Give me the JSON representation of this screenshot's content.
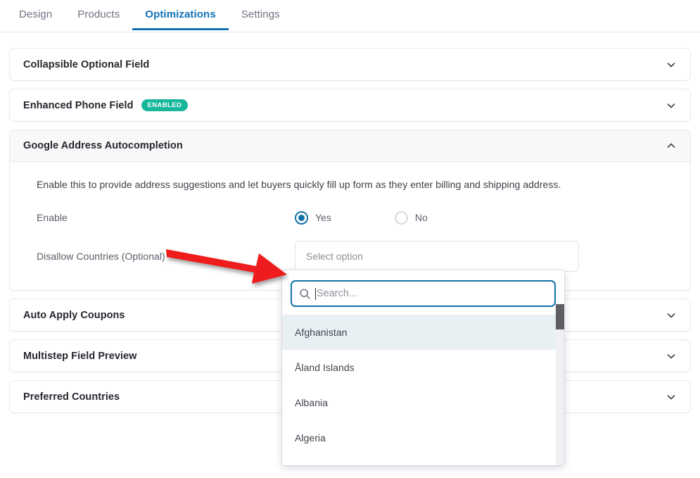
{
  "tabs": [
    {
      "label": "Design",
      "active": false
    },
    {
      "label": "Products",
      "active": false
    },
    {
      "label": "Optimizations",
      "active": true
    },
    {
      "label": "Settings",
      "active": false
    }
  ],
  "panels": {
    "collapsible_optional_field": {
      "title": "Collapsible Optional Field",
      "chevron": "chevron-down-icon"
    },
    "enhanced_phone_field": {
      "title": "Enhanced Phone Field",
      "badge": "ENABLED",
      "chevron": "chevron-down-icon"
    },
    "google_address_autocompletion": {
      "title": "Google Address Autocompletion",
      "chevron": "chevron-up-icon",
      "description": "Enable this to provide address suggestions and let buyers quickly fill up form as they enter billing and shipping address.",
      "enable": {
        "label": "Enable",
        "options": [
          {
            "label": "Yes",
            "selected": true
          },
          {
            "label": "No",
            "selected": false
          }
        ]
      },
      "disallow_countries": {
        "label": "Disallow Countries (Optional)",
        "select_placeholder": "Select option"
      }
    },
    "auto_apply_coupons": {
      "title": "Auto Apply Coupons",
      "chevron": "chevron-down-icon"
    },
    "multistep_field_preview": {
      "title": "Multistep Field Preview",
      "chevron": "chevron-down-icon"
    },
    "preferred_countries": {
      "title": "Preferred Countries",
      "chevron": "chevron-down-icon"
    }
  },
  "dropdown": {
    "search_placeholder": "Search...",
    "search_value": "",
    "options": [
      {
        "label": "Afghanistan",
        "highlighted": true
      },
      {
        "label": "Åland Islands",
        "highlighted": false
      },
      {
        "label": "Albania",
        "highlighted": false
      },
      {
        "label": "Algeria",
        "highlighted": false
      }
    ]
  },
  "annotation": {
    "arrow_color": "#ee1c1c"
  },
  "colors": {
    "accent_blue": "#1272b6",
    "radio_blue": "#1272a8",
    "badge_teal": "#17b79b",
    "panel_border": "#e9e9f0",
    "panel_head_bg": "#f8f8f9",
    "option_highlight": "#e9f0f4",
    "arrow_red": "#ee1c1c"
  }
}
